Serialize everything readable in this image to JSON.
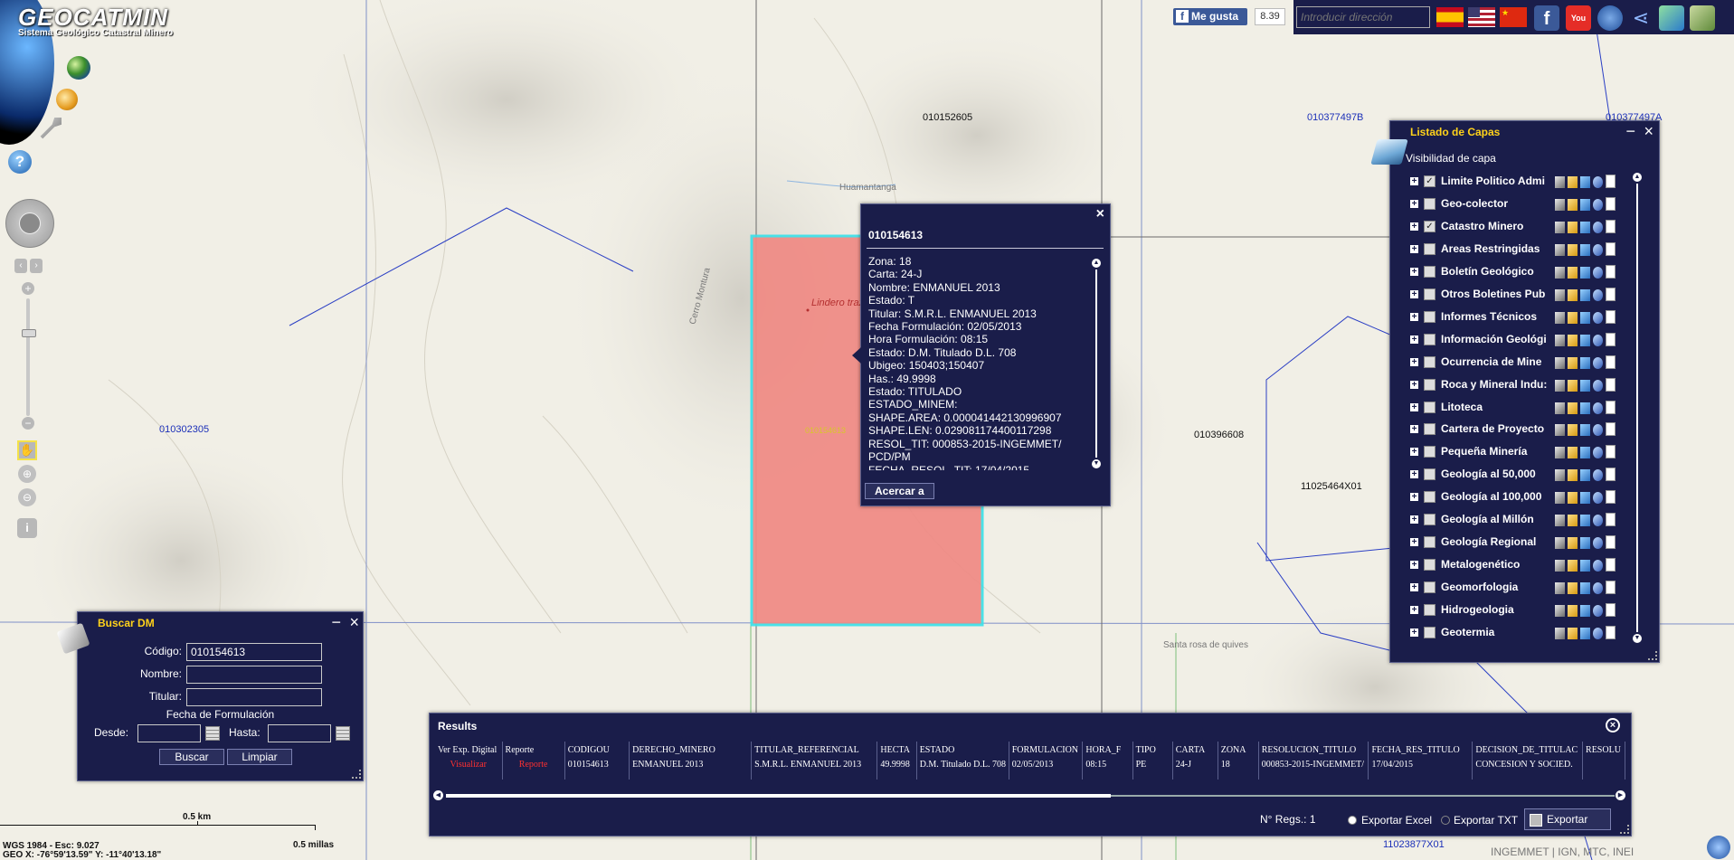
{
  "app": {
    "logo_text": "GEOCATMIN",
    "logo_subtitle": "Sistema Geológico Catastral Minero"
  },
  "topbar": {
    "like_label": "Me gusta",
    "like_count": "8.39",
    "address_placeholder": "Introducir dirección",
    "icons": [
      "spain-flag-icon",
      "usa-flag-icon",
      "china-flag-icon",
      "facebook-icon",
      "youtube-icon",
      "grid-icon",
      "share-icon",
      "layers-3d-icon"
    ]
  },
  "map_labels": {
    "l1": "010152605",
    "l2": "010377497B",
    "l3": "010377497A",
    "l4": "Huamantanga",
    "l5": "Lindero trazado",
    "l6": "Cerro Montura",
    "l7": "010302305",
    "l8": "010396608",
    "l9": "11025464X01",
    "l10": "010154613",
    "l11": "Santa rosa de quives",
    "l12": "11023877X01",
    "l13": "010154613"
  },
  "popup": {
    "title": "010154613",
    "lines": [
      "Zona: 18",
      "Carta: 24-J",
      "Nombre: ENMANUEL 2013",
      "Estado: T",
      "Titular: S.M.R.L. ENMANUEL 2013",
      "Fecha Formulación: 02/05/2013",
      "Hora Formulación: 08:15",
      "Estado: D.M. Titulado D.L. 708",
      "Ubigeo: 150403;150407",
      "Has.: 49.9998",
      "Estado: TITULADO",
      "ESTADO_MINEM:",
      "SHAPE.AREA: 0.000041442130996907",
      "SHAPE.LEN: 0.029081174400117298",
      "RESOL_TIT: 000853-2015-INGEMMET/",
      "PCD/PM",
      "FECHA_RESOL_TIT: 17/04/2015"
    ],
    "zoom_button": "Acercar a",
    "close": "×"
  },
  "layers": {
    "title": "Listado de Capas",
    "subtitle": "Visibilidad de capa",
    "items": [
      {
        "name": "Limite Politico Admi",
        "checked": true
      },
      {
        "name": "Geo-colector",
        "checked": false
      },
      {
        "name": "Catastro Minero",
        "checked": true
      },
      {
        "name": "Areas Restringidas",
        "checked": false
      },
      {
        "name": "Boletín Geológico",
        "checked": false
      },
      {
        "name": "Otros Boletines Pub",
        "checked": false
      },
      {
        "name": "Informes Técnicos",
        "checked": false
      },
      {
        "name": "Información Geológi",
        "checked": false
      },
      {
        "name": "Ocurrencia de Mine",
        "checked": false
      },
      {
        "name": "Roca y Mineral Indu:",
        "checked": false
      },
      {
        "name": "Litoteca",
        "checked": false
      },
      {
        "name": "Cartera de Proyecto",
        "checked": false
      },
      {
        "name": "Pequeña Minería",
        "checked": false
      },
      {
        "name": "Geología al 50,000",
        "checked": false
      },
      {
        "name": "Geología al 100,000",
        "checked": false
      },
      {
        "name": "Geología al Millón",
        "checked": false
      },
      {
        "name": "Geología Regional",
        "checked": false
      },
      {
        "name": "Metalogenético",
        "checked": false
      },
      {
        "name": "Geomorfologia",
        "checked": false
      },
      {
        "name": "Hidrogeologia",
        "checked": false
      },
      {
        "name": "Geotermia",
        "checked": false
      }
    ]
  },
  "search": {
    "title": "Buscar DM",
    "codigo_label": "Código:",
    "codigo_value": "010154613",
    "nombre_label": "Nombre:",
    "titular_label": "Titular:",
    "fecha_label": "Fecha de Formulación",
    "desde_label": "Desde:",
    "hasta_label": "Hasta:",
    "buscar": "Buscar",
    "limpiar": "Limpiar"
  },
  "results": {
    "title": "Results",
    "columns": [
      "Ver Exp. Digital",
      "Reporte",
      "CODIGOU",
      "DERECHO_MINERO",
      "TITULAR_REFERENCIAL",
      "HECTA",
      "ESTADO",
      "FORMULACION",
      "HORA_F",
      "TIPO",
      "CARTA",
      "ZONA",
      "RESOLUCION_TITULO",
      "FECHA_RES_TITULO",
      "DECISION_DE_TITULAC",
      "RESOLU"
    ],
    "rows": [
      [
        "Visualizar",
        "Reporte",
        "010154613",
        "ENMANUEL 2013",
        "S.M.R.L. ENMANUEL 2013",
        "49.9998",
        "D.M. Titulado D.L. 708",
        "02/05/2013",
        "08:15",
        "PE",
        "24-J",
        "18",
        "000853-2015-INGEMMET/",
        "17/04/2015",
        "CONCESION Y  SOCIED.",
        ""
      ]
    ],
    "count_label": "N° Regs.: 1",
    "export_excel": "Exportar Excel",
    "export_txt": "Exportar TXT",
    "export_button": "Exportar"
  },
  "footer": {
    "scale_km": "0.5 km",
    "scale_mi": "0.5 millas",
    "projection": "WGS 1984 - Esc: 9.027",
    "coords": "GEO X: -76°59'13.59\"  Y: -11°40'13.18\"",
    "credits": "INGEMMET | IGN, MTC, INEI"
  },
  "colors": {
    "panel": "#1a1d4a",
    "title_yellow": "#ffd21a",
    "polygon_fill": "#f08a84",
    "polygon_border": "#3de0e8"
  }
}
